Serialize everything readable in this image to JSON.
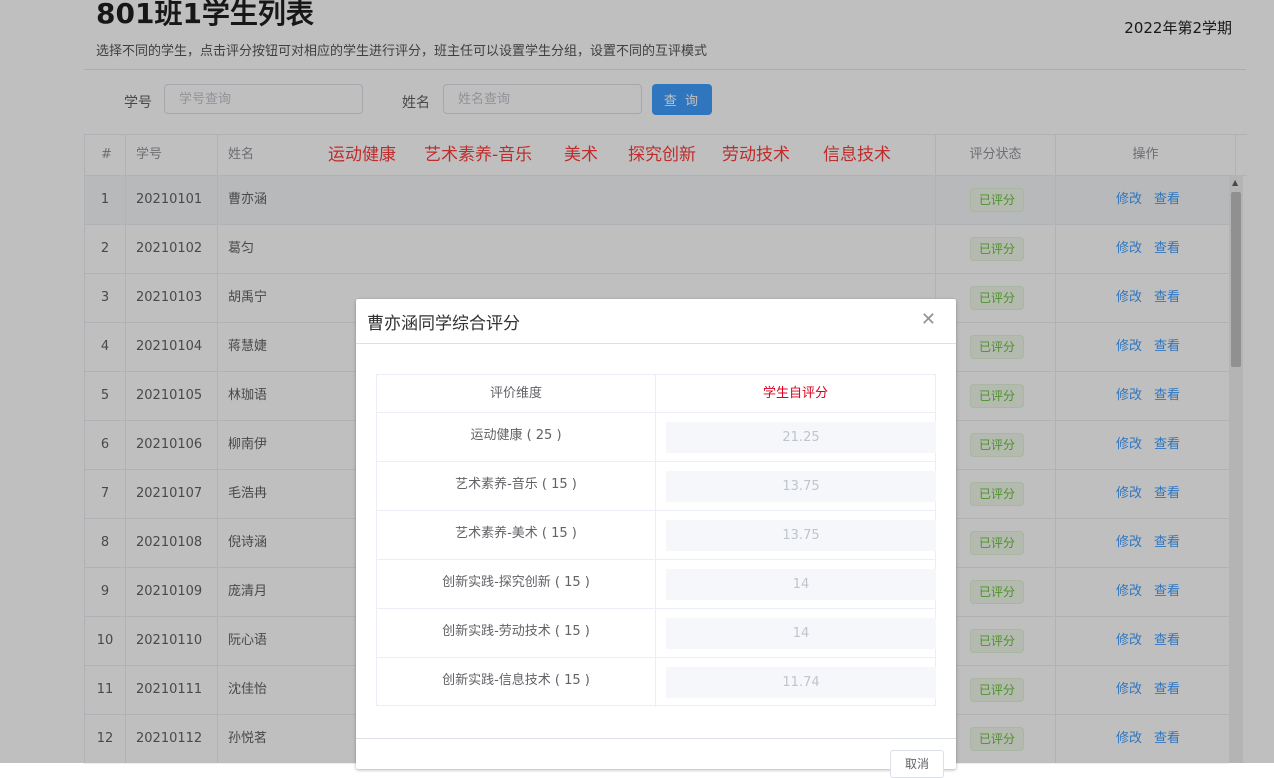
{
  "header": {
    "title": "801班1学生列表",
    "subtitle": "选择不同的学生，点击评分按钮可对相应的学生进行评分，班主任可以设置学生分组，设置不同的互评模式",
    "term": "2022年第2学期"
  },
  "search": {
    "id_label": "学号",
    "id_placeholder": "学号查询",
    "name_label": "姓名",
    "name_placeholder": "姓名查询",
    "button_label": "查 询"
  },
  "table": {
    "columns": {
      "index": "#",
      "student_id": "学号",
      "name": "姓名",
      "status": "评分状态",
      "actions": "操作"
    },
    "edit_label": "修改",
    "view_label": "查看",
    "rows": [
      {
        "index": "1",
        "student_id": "20210101",
        "name": "曹亦涵",
        "status": "已评分"
      },
      {
        "index": "2",
        "student_id": "20210102",
        "name": "葛匀",
        "status": "已评分"
      },
      {
        "index": "3",
        "student_id": "20210103",
        "name": "胡禹宁",
        "status": "已评分"
      },
      {
        "index": "4",
        "student_id": "20210104",
        "name": "蒋慧婕",
        "status": "已评分"
      },
      {
        "index": "5",
        "student_id": "20210105",
        "name": "林珈语",
        "status": "已评分"
      },
      {
        "index": "6",
        "student_id": "20210106",
        "name": "柳南伊",
        "status": "已评分"
      },
      {
        "index": "7",
        "student_id": "20210107",
        "name": "毛浩冉",
        "status": "已评分"
      },
      {
        "index": "8",
        "student_id": "20210108",
        "name": "倪诗涵",
        "status": "已评分"
      },
      {
        "index": "9",
        "student_id": "20210109",
        "name": "庞清月",
        "status": "已评分"
      },
      {
        "index": "10",
        "student_id": "20210110",
        "name": "阮心语",
        "status": "已评分"
      },
      {
        "index": "11",
        "student_id": "20210111",
        "name": "沈佳怡",
        "status": "已评分"
      },
      {
        "index": "12",
        "student_id": "20210112",
        "name": "孙悦茗",
        "status": "已评分"
      }
    ]
  },
  "annotations": [
    "运动健康",
    "艺术素养-音乐",
    "美术",
    "探究创新",
    "劳动技术",
    "信息技术"
  ],
  "dialog": {
    "title": "曹亦涵同学综合评分",
    "close_icon": "close-icon",
    "col_dimension": "评价维度",
    "col_self_score": "学生自评分",
    "accent_color": "#d9001b",
    "items": [
      {
        "label": "运动健康 ( 25 )",
        "score": "21.25"
      },
      {
        "label": "艺术素养-音乐 ( 15 )",
        "score": "13.75"
      },
      {
        "label": "艺术素养-美术 ( 15 )",
        "score": "13.75"
      },
      {
        "label": "创新实践-探究创新 ( 15 )",
        "score": "14"
      },
      {
        "label": "创新实践-劳动技术 ( 15 )",
        "score": "14"
      },
      {
        "label": "创新实践-信息技术 ( 15 )",
        "score": "11.74"
      }
    ],
    "cancel_label": "取消"
  }
}
